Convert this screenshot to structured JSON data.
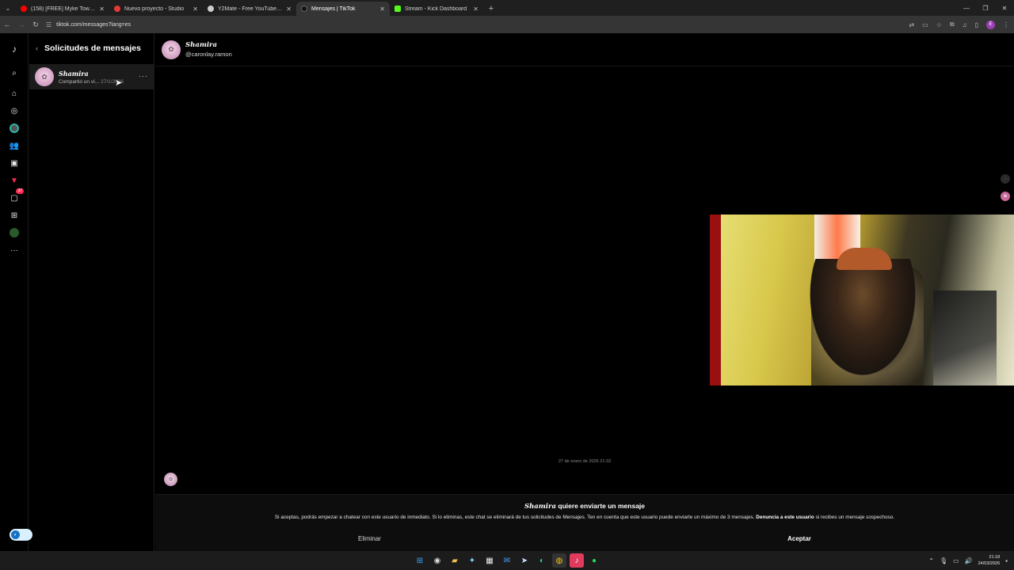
{
  "browser": {
    "tabs": [
      {
        "title": "(158) [FREE] Myke Towers Typo",
        "favicon_color": "#ff0000"
      },
      {
        "title": "Nuevo proyecto - Studio",
        "favicon_color": "#e53935"
      },
      {
        "title": "Y2Mate - Free YouTube to MP3",
        "favicon_color": "#cccccc"
      },
      {
        "title": "Mensajes | TikTok",
        "favicon_color": "#111111",
        "active": true
      },
      {
        "title": "Stream - Kick Dashboard",
        "favicon_color": "#53fc18"
      }
    ],
    "tab_close": "✕",
    "new_tab": "+",
    "url": "tiktok.com/messages?lang=es",
    "profile_initial": "E"
  },
  "rail": {
    "notification_count": "37"
  },
  "requests": {
    "title": "Solicitudes de mensajes",
    "items": [
      {
        "name": "𝑺𝒉𝒂𝒎𝒊𝒓𝒂",
        "preview": "Compartió un ví...",
        "date": "27/1/2026"
      }
    ]
  },
  "chat": {
    "name": "𝑺𝒉𝒂𝒎𝒊𝒓𝒂",
    "handle": "@caronlay.ramon",
    "message_date": "27 de enero de 2026 21:33",
    "request_title_suffix": "quiere enviarte un mensaje",
    "request_desc": "Si aceptas, podrás empezar a chatear con este usuario de inmediato. Si lo eliminas, este chat se eliminará de tus solicitudes de Mensajes. Ten en cuenta que este usuario puede enviarte un máximo de 3 mensajes.",
    "report_link": "Denuncia a este usuario",
    "report_suffix": "si recibes un mensaje sospechoso.",
    "delete_label": "Eliminar",
    "accept_label": "Aceptar"
  },
  "taskbar": {
    "time": "21:18",
    "date": "24/03/2026"
  }
}
